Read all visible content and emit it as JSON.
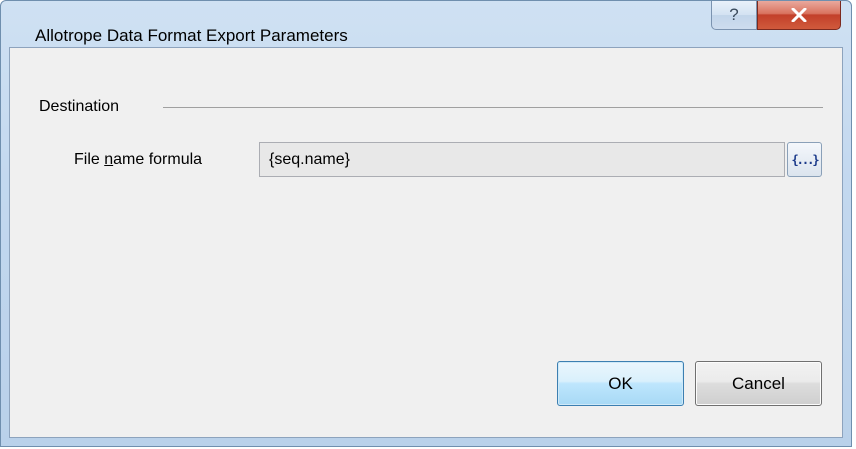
{
  "window": {
    "title": "Allotrope Data Format Export Parameters",
    "help_glyph": "?",
    "close_icon": "close-icon",
    "help_icon": "help-icon"
  },
  "destination": {
    "group_label": "Destination",
    "field_label_prefix": "File ",
    "field_label_mnemonic": "n",
    "field_label_suffix": "ame formula",
    "field_value": "{seq.name}",
    "formula_button_glyph": "{...}"
  },
  "buttons": {
    "ok_label": "OK",
    "cancel_label": "Cancel"
  },
  "colors": {
    "close_button": "#c2402a",
    "ok_button_border": "#3c7fb1",
    "formula_glyph": "#1b3a8a"
  }
}
